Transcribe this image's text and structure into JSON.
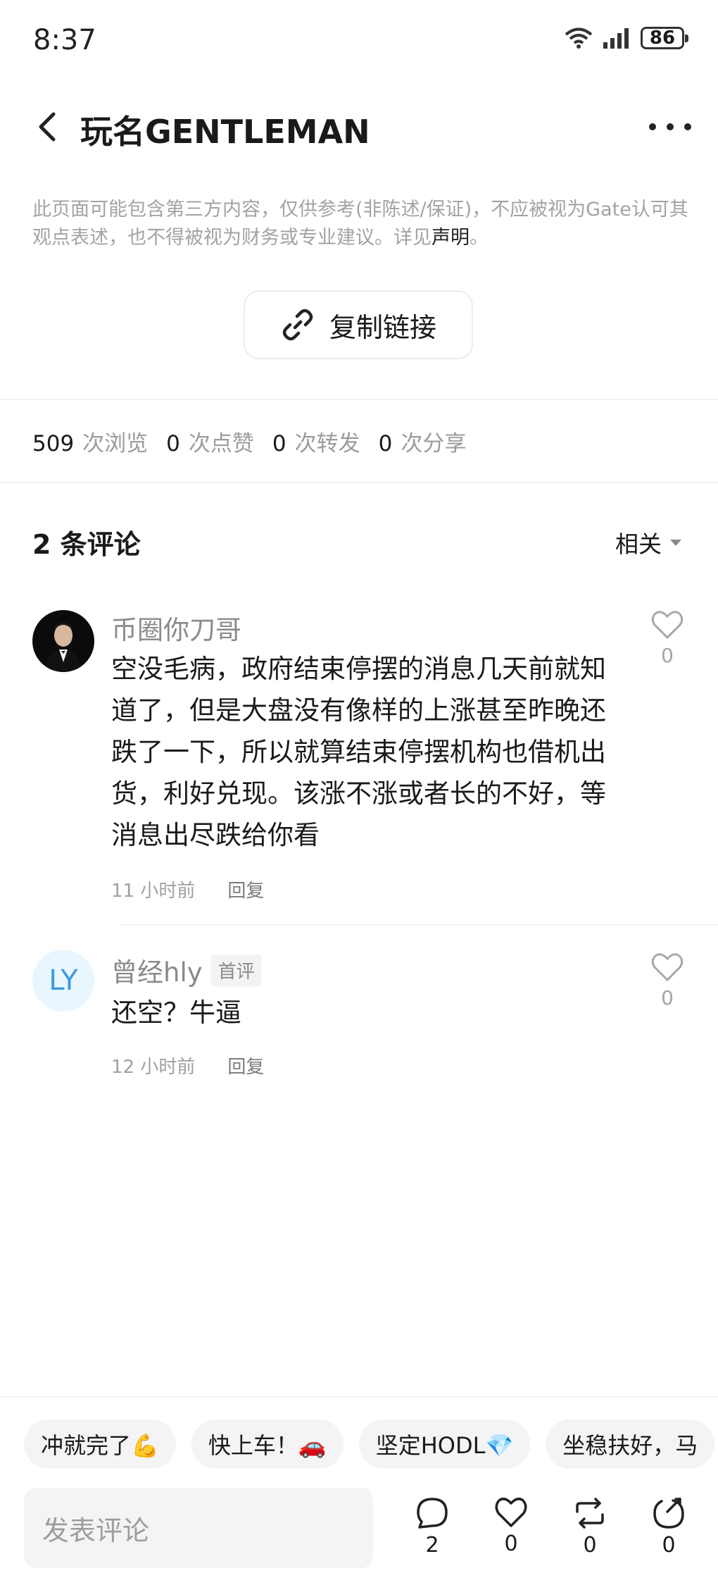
{
  "status": {
    "time": "8:37",
    "battery": "86"
  },
  "header": {
    "title": "玩名GENTLEMAN"
  },
  "disclaimer": {
    "text": "此页面可能包含第三方内容，仅供参考(非陈述/保证)，不应被视为Gate认可其观点表述，也不得被视为财务或专业建议。详见",
    "link": "声明",
    "tail": "。"
  },
  "copy_link": {
    "label": "复制链接"
  },
  "stats": [
    {
      "value": "509",
      "label": "次浏览"
    },
    {
      "value": "0",
      "label": "次点赞"
    },
    {
      "value": "0",
      "label": "次转发"
    },
    {
      "value": "0",
      "label": "次分享"
    }
  ],
  "comments_header": {
    "count_label": "2 条评论",
    "sort_label": "相关"
  },
  "comments": [
    {
      "author": "币圈你刀哥",
      "text": "空没毛病，政府结束停摆的消息几天前就知道了，但是大盘没有像样的上涨甚至昨晚还跌了一下，所以就算结束停摆机构也借机出货，利好兑现。该涨不涨或者长的不好，等消息出尽跌给你看",
      "time": "11 小时前",
      "reply": "回复",
      "likes": "0"
    },
    {
      "author": "曾经hly",
      "avatar_text": "LY",
      "badge": "首评",
      "text": "还空？牛逼",
      "time": "12 小时前",
      "reply": "回复",
      "likes": "0"
    }
  ],
  "quick_replies": [
    "冲就完了💪",
    "快上车！🚗",
    "坚定HODL💎",
    "坐稳扶好，马"
  ],
  "bottom_bar": {
    "input_placeholder": "发表评论",
    "comments": "2",
    "likes": "0",
    "reposts": "0",
    "shares": "0"
  },
  "colors": {
    "accent_blue": "#3a9ce2",
    "muted_text": "#a3a3a3"
  }
}
